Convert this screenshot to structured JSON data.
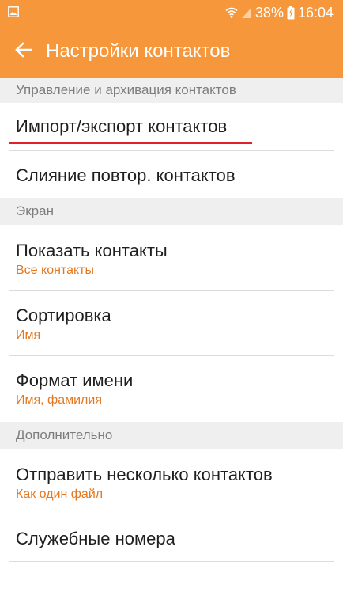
{
  "status_bar": {
    "battery": "38%",
    "time": "16:04"
  },
  "app_bar": {
    "title": "Настройки контактов"
  },
  "sections": [
    {
      "header": "Управление и архивация контактов",
      "items": [
        {
          "label": "Импорт/экспорт контактов"
        },
        {
          "label": "Слияние повтор. контактов"
        }
      ]
    },
    {
      "header": "Экран",
      "items": [
        {
          "label": "Показать контакты",
          "value": "Все контакты"
        },
        {
          "label": "Сортировка",
          "value": "Имя"
        },
        {
          "label": "Формат имени",
          "value": "Имя, фамилия"
        }
      ]
    },
    {
      "header": "Дополнительно",
      "items": [
        {
          "label": "Отправить несколько контактов",
          "value": "Как один файл"
        },
        {
          "label": "Служебные номера"
        }
      ]
    }
  ],
  "colors": {
    "accent": "#f6973b",
    "value_text": "#e5781f",
    "highlight_underline": "#e0202a"
  },
  "icons": {
    "status_left": "gallery-icon",
    "wifi": "wifi-icon",
    "signal": "signal-icon",
    "battery": "battery-charging-icon",
    "back": "back-arrow-icon"
  }
}
